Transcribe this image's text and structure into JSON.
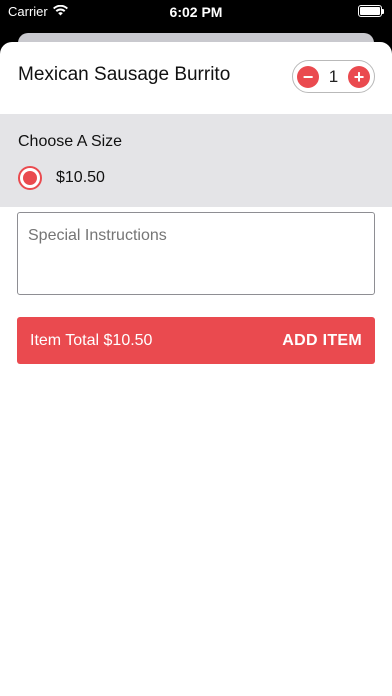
{
  "status_bar": {
    "carrier": "Carrier",
    "time": "6:02 PM",
    "icons": [
      "wifi-icon",
      "battery-icon"
    ]
  },
  "item": {
    "title": "Mexican Sausage Burrito",
    "quantity": "1",
    "decrement_symbol": "−",
    "increment_symbol": "+"
  },
  "size": {
    "heading": "Choose A Size",
    "options": [
      {
        "label": "$10.50",
        "selected": true
      }
    ]
  },
  "instructions": {
    "placeholder": "Special Instructions",
    "value": ""
  },
  "footer": {
    "total_label": "Item Total $10.50",
    "add_label": "ADD ITEM"
  },
  "colors": {
    "accent": "#ea4a4f",
    "section_bg": "#e4e4e7"
  }
}
